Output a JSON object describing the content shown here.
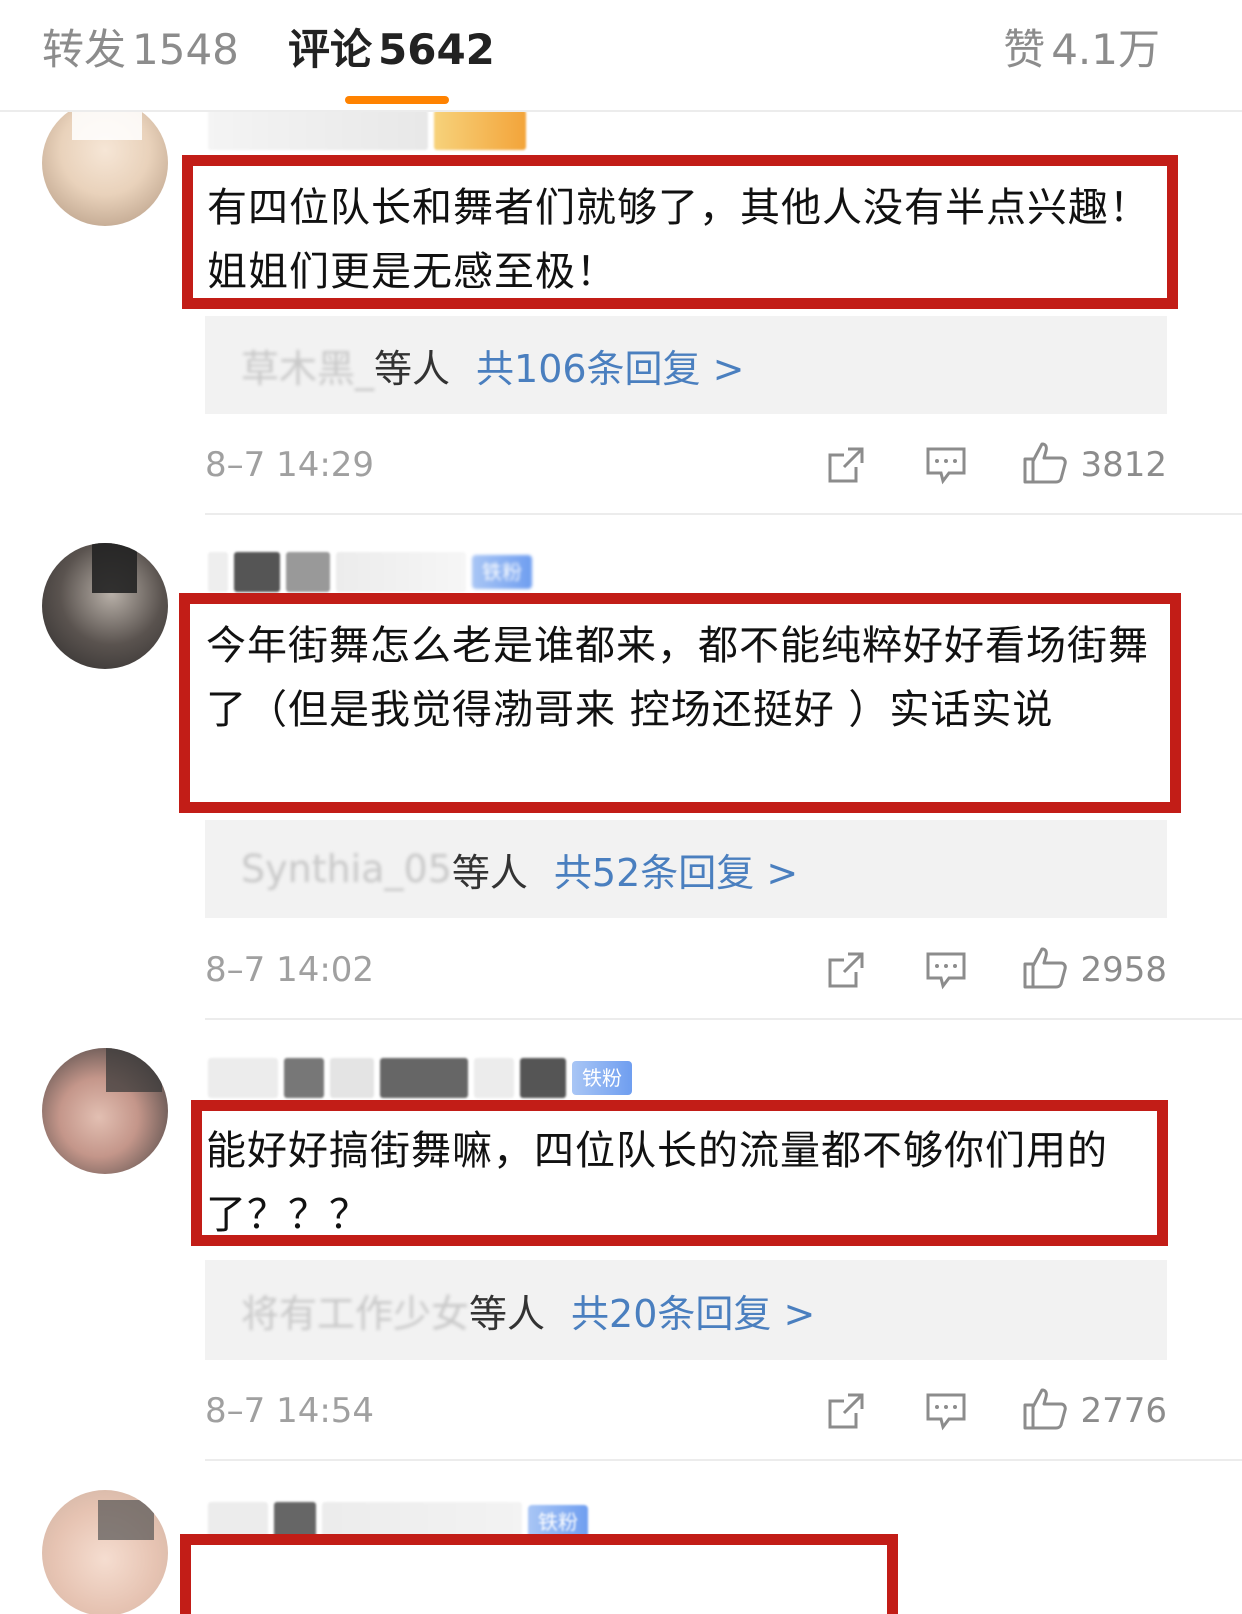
{
  "tabs": {
    "repost": {
      "label": "转发",
      "count": "1548"
    },
    "comments": {
      "label": "评论",
      "count": "5642"
    },
    "likes": {
      "label": "赞",
      "count": "4.1万"
    }
  },
  "comments": [
    {
      "text": "有四位队长和舞者们就够了，其他人没有半点兴趣！姐姐们更是无感至极！",
      "reply_names": "草木黑_",
      "reply_suffix": "等人",
      "reply_count": "共106条回复 >",
      "time": "8–7 14:29",
      "likes": "3812"
    },
    {
      "text": "今年街舞怎么老是谁都来，都不能纯粹好好看场街舞了（但是我觉得渤哥来 控场还挺好 ）实话实说",
      "badge": "铁粉",
      "reply_names": "Synthia_05",
      "reply_suffix": "等人",
      "reply_count": "共52条回复 >",
      "time": "8–7 14:02",
      "likes": "2958"
    },
    {
      "text": "能好好搞街舞嘛，四位队长的流量都不够你们用的了？？？",
      "badge": "铁粉",
      "reply_names": "将有工作少女",
      "reply_suffix": "等人",
      "reply_count": "共20条回复 >",
      "time": "8–7 14:54",
      "likes": "2776"
    },
    {
      "badge": "铁粉"
    }
  ],
  "icons": {
    "share": "share-icon",
    "reply": "comment-icon",
    "like": "thumbs-up-icon"
  },
  "colors": {
    "accent": "#ff8200",
    "highlight_border": "#c21d17",
    "link": "#4a7fbf"
  }
}
